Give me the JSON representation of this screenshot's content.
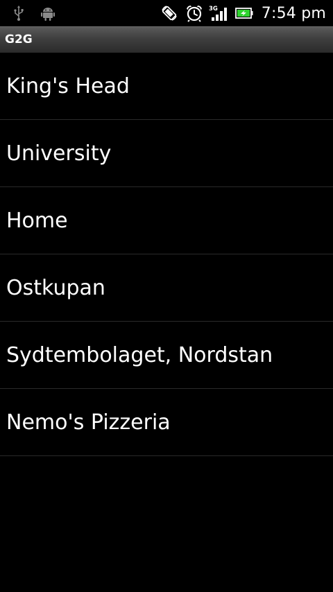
{
  "status_bar": {
    "left_icons": [
      "usb-icon",
      "android-debug-icon"
    ],
    "right_icons": [
      "screen-rotation-icon",
      "alarm-clock-icon",
      "signal-3g-icon",
      "battery-charging-icon"
    ],
    "network_type": "3G",
    "time": "7:54 pm"
  },
  "app_bar": {
    "title": "G2G"
  },
  "places": [
    {
      "label": "King's Head"
    },
    {
      "label": "University"
    },
    {
      "label": "Home"
    },
    {
      "label": "Ostkupan"
    },
    {
      "label": "Sydtembolaget, Nordstan"
    },
    {
      "label": "Nemo's Pizzeria"
    }
  ],
  "colors": {
    "background": "#000000",
    "text": "#ffffff",
    "divider": "#2a2a2a",
    "battery_fill": "#2fd32f"
  }
}
